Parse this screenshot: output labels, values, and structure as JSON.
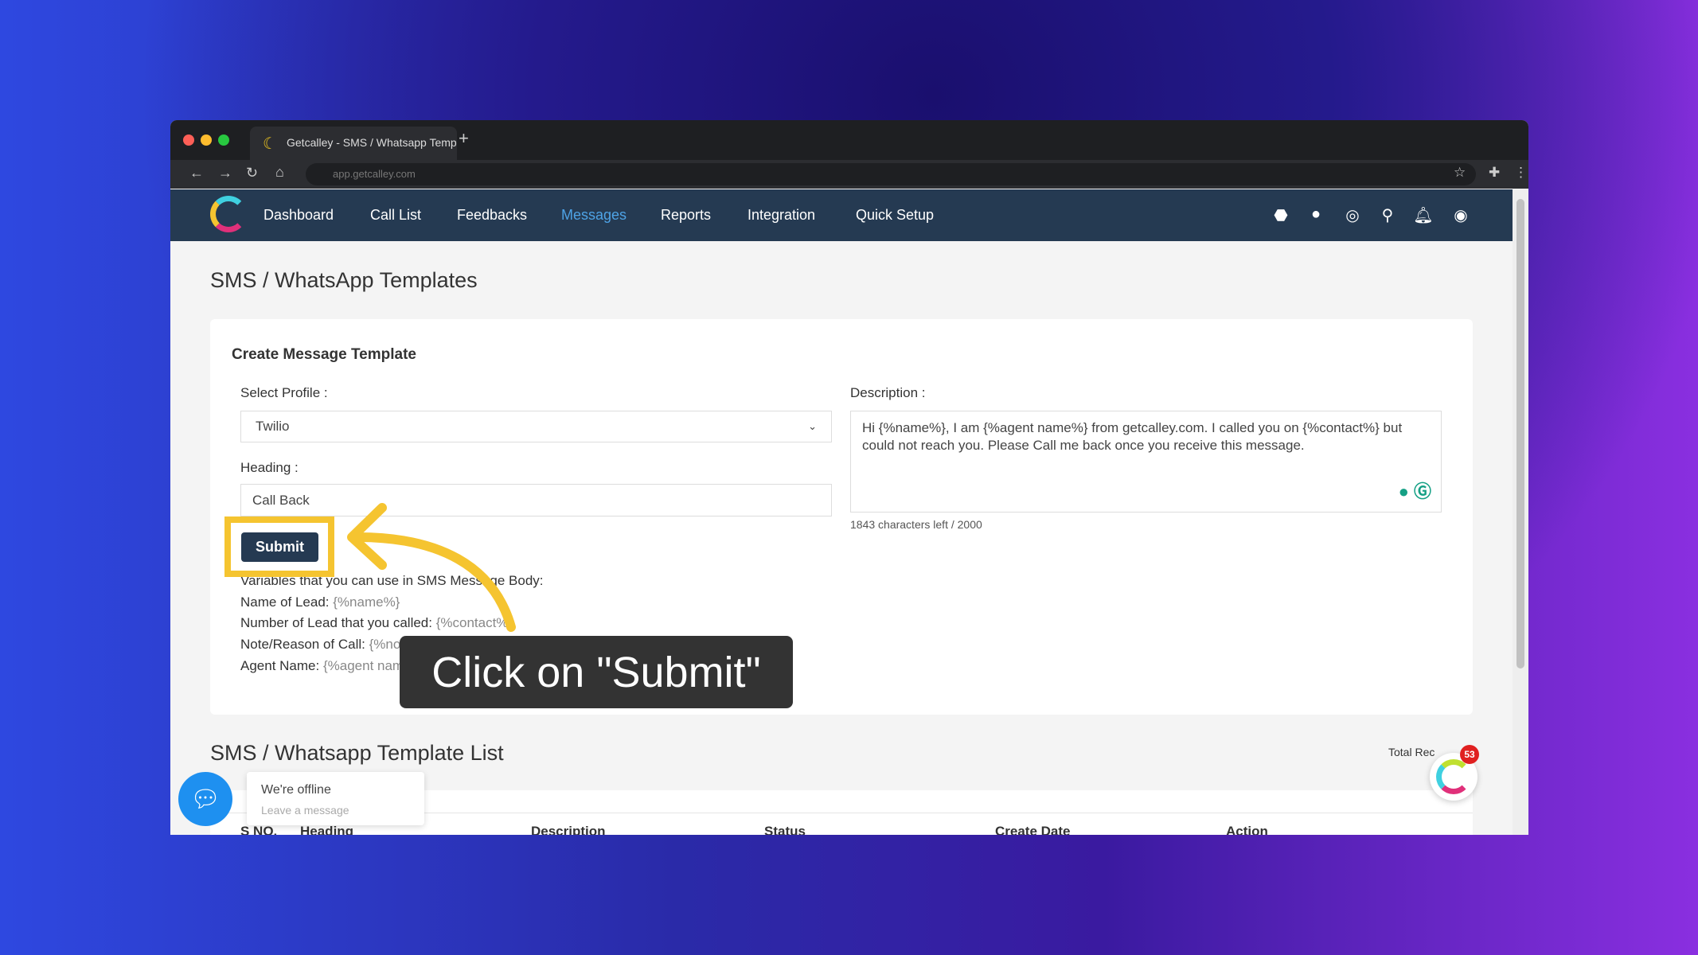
{
  "browser": {
    "tab_title": "Getcalley - SMS / Whatsapp Temp",
    "url": "app.getcalley.com"
  },
  "nav": {
    "items": [
      "Dashboard",
      "Call List",
      "Feedbacks",
      "Messages",
      "Reports",
      "Integration",
      "Quick Setup"
    ],
    "active": "Messages",
    "icons": [
      "android-icon",
      "apple-icon",
      "support-icon",
      "search-icon",
      "bell-icon",
      "user-icon"
    ]
  },
  "page": {
    "title": "SMS / WhatsApp Templates"
  },
  "form": {
    "title": "Create Message Template",
    "profile_label": "Select Profile :",
    "profile_value": "Twilio",
    "heading_label": "Heading :",
    "heading_value": "Call Back",
    "submit_label": "Submit",
    "description_label": "Description :",
    "description_value": "Hi {%name%}, I am {%agent name%} from getcalley.com. I called you on {%contact%} but could not reach you. Please Call me back once you receive this message.",
    "char_count": "1843 characters left / 2000",
    "variables_intro": "Variables that you can use in SMS Message Body:",
    "variables": [
      {
        "label": "Name of Lead: ",
        "value": "{%name%}"
      },
      {
        "label": "Number of Lead that you called: ",
        "value": "{%contact%}"
      },
      {
        "label": "Note/Reason of Call: ",
        "value": "{%notes%}"
      },
      {
        "label": "Agent Name: ",
        "value": "{%agent name%}"
      }
    ]
  },
  "callout": {
    "text": "Click on \"Submit\"",
    "color": "#f5c430"
  },
  "list": {
    "title": "SMS / Whatsapp Template List",
    "total_label": "Total Rec",
    "columns": [
      "S NO.",
      "Heading",
      "Description",
      "Status",
      "Create Date",
      "Action"
    ]
  },
  "chat": {
    "status": "We're offline",
    "sub": "Leave a message"
  },
  "widget": {
    "badge": "53"
  }
}
